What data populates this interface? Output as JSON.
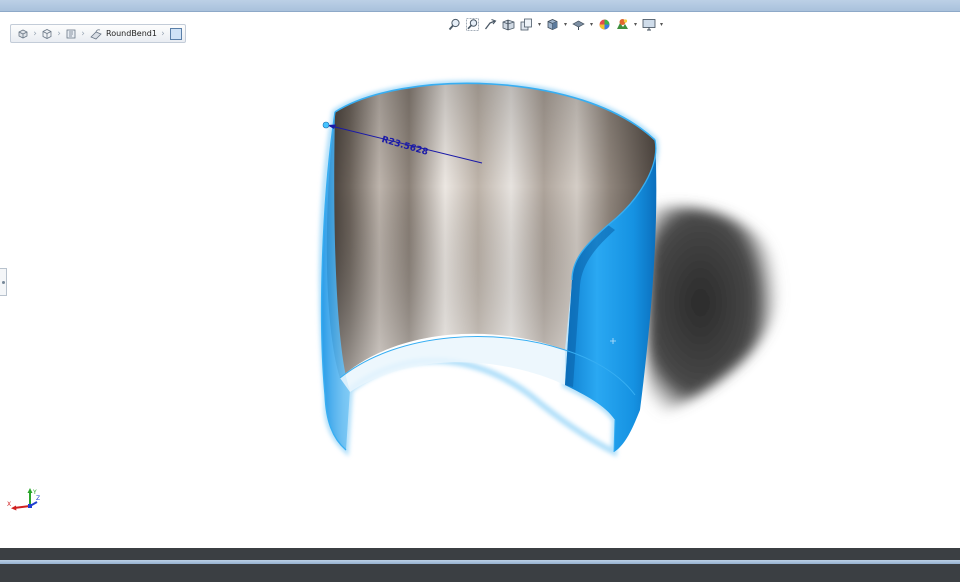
{
  "breadcrumb": {
    "items": [
      {
        "icon": "part-icon"
      },
      {
        "icon": "cube-icon"
      },
      {
        "icon": "sheetmetal-icon"
      },
      {
        "icon": "round-bend-icon",
        "label": "RoundBend1"
      }
    ],
    "end_icon": "selection-box-icon"
  },
  "heads_up_toolbar": [
    "zoom-to-fit-icon",
    "zoom-to-area-icon",
    "previous-view-icon",
    "section-view-icon",
    "dynamic-annotation-icon",
    "view-orientation-icon",
    "display-style-icon",
    "hide-show-items-icon",
    "edit-appearance-icon",
    "apply-scene-icon",
    "view-settings-icon"
  ],
  "dimension": {
    "label": "R23.5628"
  },
  "triad": {
    "x": "X",
    "y": "Y",
    "z": "Z"
  },
  "colors": {
    "selection_blue": "#1e9be8",
    "dimension_blue": "#1a1aa8",
    "steel_light": "#e4e0dc",
    "steel_dark": "#4e4640"
  }
}
